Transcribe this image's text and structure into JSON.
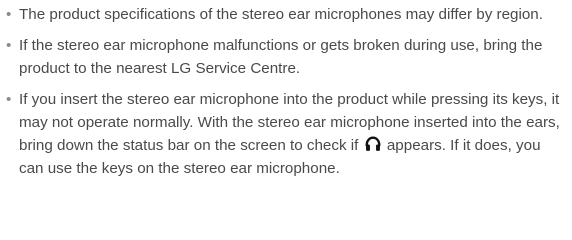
{
  "notes": [
    {
      "bullet": "•",
      "text": "The product specifications of the stereo ear microphones may differ by region."
    },
    {
      "bullet": "•",
      "text": "If the stereo ear microphone malfunctions or gets broken during use, bring the product to the nearest LG Service Centre."
    },
    {
      "bullet": "•",
      "text_before_icon": "If you insert the stereo ear microphone into the product while pressing its keys, it may not operate normally. With the stereo ear microphone inserted into the ears, bring down the status bar on the screen to check if",
      "icon": "headset-icon",
      "text_after_icon": "appears. If it does, you can use the keys on the stereo ear microphone."
    }
  ],
  "colors": {
    "text": "#4a4a4a",
    "bullet": "#8a8a8a",
    "icon": "#111111"
  }
}
